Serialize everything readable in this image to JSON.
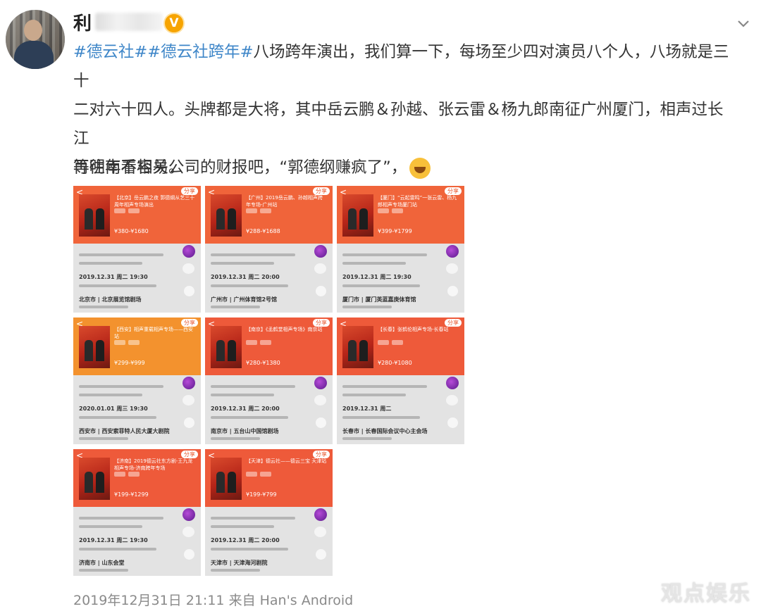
{
  "post": {
    "author_visible": "利",
    "verified_badge": "V",
    "tags": [
      "#德云社#",
      "#德云社跨年#"
    ],
    "body_line1": "八场跨年演出，我们算一下，每场至少四对演员八个人，八场就是三十",
    "body_line2": "二对六十四人。头牌都是大将，其中岳云鹏＆孙越、张云雷＆杨九郎南征广州厦门，相声过长江",
    "body_line3": "再往南不容易。",
    "body_para2": "等明年看相关公司的财报吧，“郭德纲赚疯了”，",
    "timestamp": "2019年12月31日 21:11",
    "source": "来自 Han's Android"
  },
  "cards": [
    {
      "title": "【北京】岳云鹏之夜 郭德纲从艺三十周年相声专场演出",
      "price": "¥380-¥1680",
      "date": "2019.12.31 周二 19:30",
      "venue": "北京市 | 北京展览馆剧场",
      "color": "#f0643a"
    },
    {
      "title": "【广州】2019岳云鹏、孙越相声跨年专场-广州站",
      "price": "¥288-¥1688",
      "date": "2019.12.31 周二 20:00",
      "venue": "广州市 | 广州体育馆2号馆",
      "color": "#f0643a"
    },
    {
      "title": "【厦门】“云起雷鸣”一张云雷、杨九郎相声专场厦门站",
      "price": "¥399-¥1799",
      "date": "2019.12.31 周二 19:30",
      "venue": "厦门市 | 厦门英蓝嘉庚体育馆",
      "color": "#f0643a"
    },
    {
      "title": "【西安】相声重载相声专场——西安站",
      "price": "¥299-¥999",
      "date": "2020.01.01 周三 19:30",
      "venue": "西安市 | 西安索菲特人民大厦大剧院",
      "color": "#f3922e"
    },
    {
      "title": "【南京】《孟鹤堂相声专场》南京站",
      "price": "¥280-¥1380",
      "date": "2019.12.31 周二 20:00",
      "venue": "南京市 | 五台山中国馆剧场",
      "color": "#ee5a3a"
    },
    {
      "title": "【长春】张鹤伦相声专场-长春站",
      "price": "¥280-¥1080",
      "date": "2019.12.31 周二",
      "venue": "长春市 | 长春国际会议中心主会场",
      "color": "#ee5a3a"
    },
    {
      "title": "【济南】2019德云社东方剧-王九龙相声专场-济南跨年专场",
      "price": "¥199-¥1299",
      "date": "2019.12.31 周二 19:30",
      "venue": "济南市 | 山东会堂",
      "color": "#ee5a3a"
    },
    {
      "title": "【天津】德云社——德云三宝 天津站",
      "price": "¥199-¥799",
      "date": "2019.12.31 周二 20:00",
      "venue": "天津市 | 天津海河剧院",
      "color": "#ee5a3a"
    }
  ],
  "watermark": "观点娱乐",
  "colors": {
    "tag": "#3e86c8",
    "badge": "#f7a400",
    "meta": "#8a8a8a"
  },
  "icons": {
    "avatar": "user-avatar",
    "verified": "verified-v-icon",
    "menu": "chevron-down-icon",
    "emoji": "laughing-emoji-icon"
  }
}
